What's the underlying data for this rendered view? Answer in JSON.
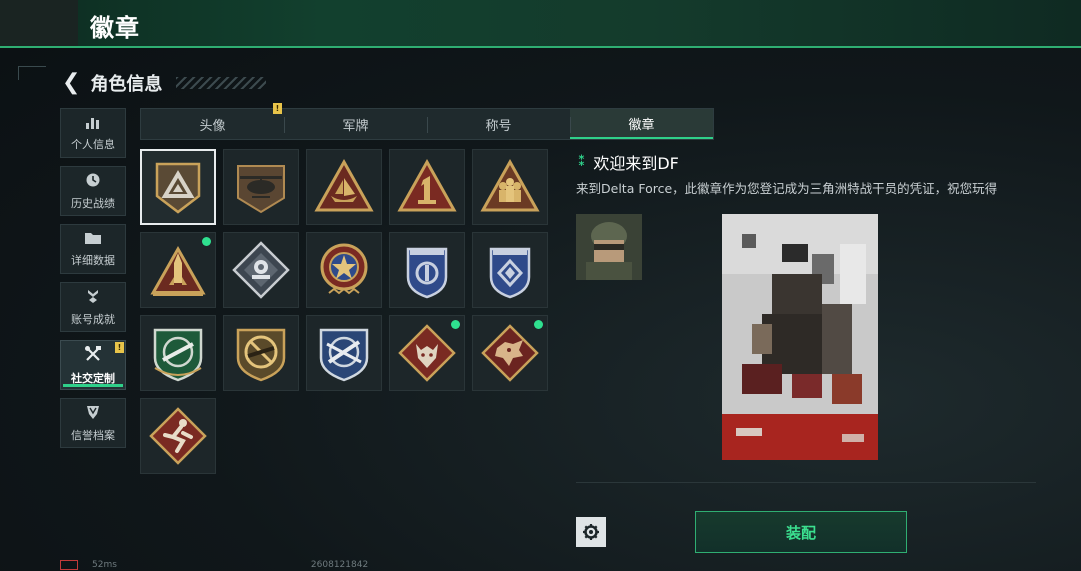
{
  "header": {
    "title": "徽章"
  },
  "nav": {
    "back_label": "角色信息"
  },
  "sidebar": {
    "items": [
      {
        "label": "个人信息",
        "icon": "bar-chart-icon"
      },
      {
        "label": "历史战绩",
        "icon": "clock-icon"
      },
      {
        "label": "详细数据",
        "icon": "folder-icon"
      },
      {
        "label": "账号成就",
        "icon": "medal-icon"
      },
      {
        "label": "社交定制",
        "icon": "tools-icon",
        "active": true,
        "badge": "!"
      },
      {
        "label": "信誉档案",
        "icon": "shield-icon"
      }
    ]
  },
  "tabs": [
    {
      "label": "头像",
      "badge": "!"
    },
    {
      "label": "军牌"
    },
    {
      "label": "称号"
    },
    {
      "label": "徽章",
      "active": true
    }
  ],
  "badges": [
    {
      "name": "triangle-shield",
      "selected": true
    },
    {
      "name": "helicopter"
    },
    {
      "name": "boat-triangle"
    },
    {
      "name": "number-one-triangle"
    },
    {
      "name": "soldiers-triangle"
    },
    {
      "name": "rocket-launch",
      "new": true
    },
    {
      "name": "gear-diamond"
    },
    {
      "name": "star-wreath"
    },
    {
      "name": "blue-shield-a"
    },
    {
      "name": "blue-shield-b"
    },
    {
      "name": "green-rifle-shield"
    },
    {
      "name": "no-rifle-shield"
    },
    {
      "name": "blue-rifle-shield"
    },
    {
      "name": "wolf-diamond",
      "new": true
    },
    {
      "name": "dragon-diamond",
      "new": true
    },
    {
      "name": "runner-diamond"
    }
  ],
  "detail": {
    "title": "欢迎来到DF",
    "description": "来到Delta Force，此徽章作为您登记成为三角洲特战干员的凭证，祝您玩得",
    "equip_label": "装配"
  },
  "footer": {
    "ping": "52ms",
    "uid": "2608121842"
  },
  "colors": {
    "accent_green": "#2fd08a",
    "header_green": "#12402e",
    "new_dot": "#2fe08f",
    "badge_gold": "#c9a25a",
    "badge_red": "#7a2a22",
    "badge_blue": "#2f4a8a"
  }
}
